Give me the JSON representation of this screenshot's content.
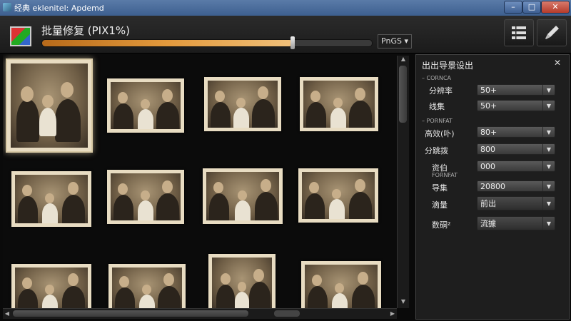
{
  "window": {
    "title": "经典 eklenitel: Apdemd",
    "min": "–",
    "max": "□",
    "close": "✕"
  },
  "header": {
    "title": "批量修复 (PIX1%)",
    "progress": 0.76,
    "format_label": "PnGS ▾"
  },
  "panel": {
    "title": "出出导景设出",
    "close": "✕",
    "sections": [
      "– CORNCA",
      "– PORNFAT"
    ],
    "sub_label": "FORNFAT",
    "rows": [
      {
        "label": "分辨率",
        "value": "50+"
      },
      {
        "label": "线集",
        "value": "50+"
      },
      {
        "label": "高效(卟)",
        "value": "80+"
      },
      {
        "label": "分跳拨",
        "value": "800"
      },
      {
        "label": "资伯",
        "value": "000"
      },
      {
        "label": "导集",
        "value": "20800"
      },
      {
        "label": "滴量",
        "value": "前出"
      },
      {
        "label": "数硐²",
        "value": "流據"
      }
    ]
  },
  "icons": {
    "list": "list-icon",
    "pen": "pen-icon",
    "logo": "image-logo-icon"
  }
}
